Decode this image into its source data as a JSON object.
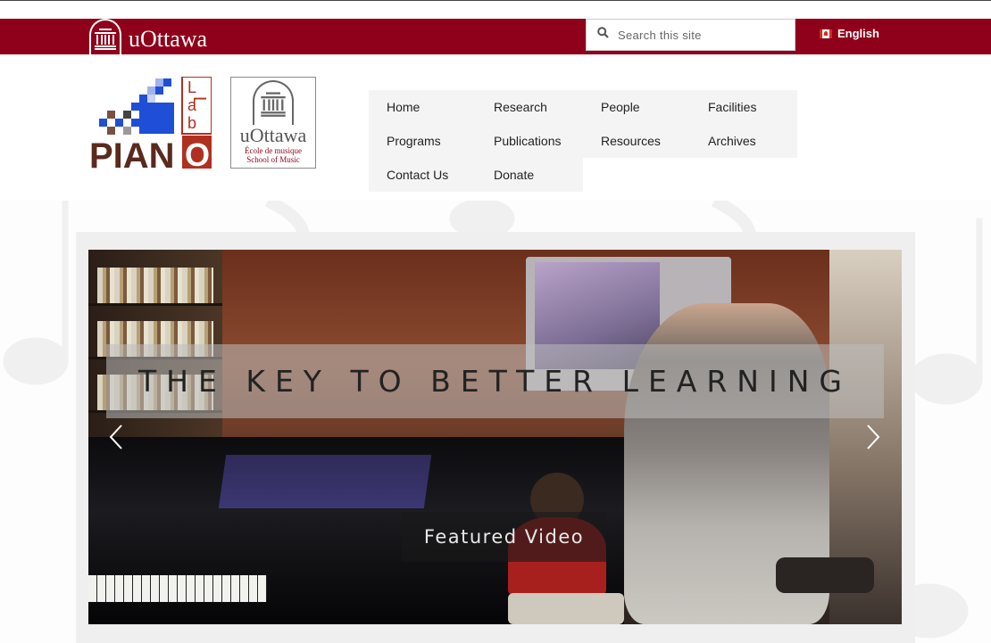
{
  "top_bar": {
    "logo_text": "uOttawa",
    "search_placeholder": "Search this site",
    "language": "English"
  },
  "header": {
    "piano_logo": {
      "letters_side": [
        "L",
        "a",
        "b"
      ],
      "word_piano": "PIAN",
      "word_o": "O"
    },
    "school_logo": {
      "name": "uOttawa",
      "line_fr": "École de musique",
      "line_en": "School of Music"
    }
  },
  "nav": {
    "items": [
      {
        "label": "Home"
      },
      {
        "label": "Research"
      },
      {
        "label": "People"
      },
      {
        "label": "Facilities"
      },
      {
        "label": "Programs"
      },
      {
        "label": "Publications"
      },
      {
        "label": "Resources"
      },
      {
        "label": "Archives"
      },
      {
        "label": "Contact Us"
      },
      {
        "label": "Donate"
      }
    ]
  },
  "hero": {
    "headline": "THE KEY TO BETTER LEARNING",
    "button_label": "Featured Video"
  },
  "colors": {
    "brand": "#8f001a",
    "nav_bg": "#f4f4f4",
    "logo_blue": "#1f4fd6",
    "logo_dark": "#5a2a1f"
  }
}
